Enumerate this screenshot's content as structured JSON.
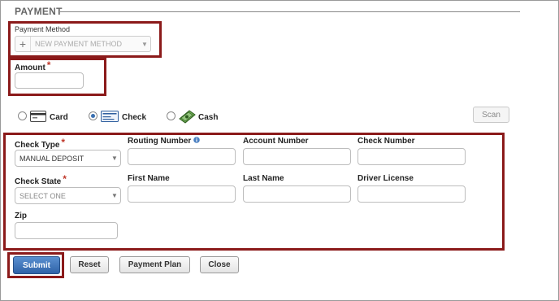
{
  "section": {
    "title": "PAYMENT"
  },
  "payment_method": {
    "label": "Payment Method",
    "placeholder": "NEW PAYMENT METHOD"
  },
  "amount": {
    "label": "Amount",
    "required_mark": "*",
    "value": ""
  },
  "payment_types": [
    {
      "label": "Card",
      "selected": false
    },
    {
      "label": "Check",
      "selected": true
    },
    {
      "label": "Cash",
      "selected": false
    }
  ],
  "scan_label": "Scan",
  "check_form": {
    "check_type": {
      "label": "Check Type",
      "required_mark": "*",
      "value": "MANUAL DEPOSIT"
    },
    "routing_number": {
      "label": "Routing Number",
      "value": ""
    },
    "account_number": {
      "label": "Account Number",
      "value": ""
    },
    "check_number": {
      "label": "Check Number",
      "value": ""
    },
    "check_state": {
      "label": "Check State",
      "required_mark": "*",
      "value": "SELECT ONE"
    },
    "first_name": {
      "label": "First Name",
      "value": ""
    },
    "last_name": {
      "label": "Last Name",
      "value": ""
    },
    "driver_license": {
      "label": "Driver License",
      "value": ""
    },
    "zip": {
      "label": "Zip",
      "value": ""
    }
  },
  "buttons": {
    "submit": "Submit",
    "reset": "Reset",
    "payment_plan": "Payment Plan",
    "close": "Close"
  },
  "colors": {
    "highlight_border": "#8b1a1a",
    "primary_button": "#2f63a8",
    "required_mark": "#c0392b"
  }
}
